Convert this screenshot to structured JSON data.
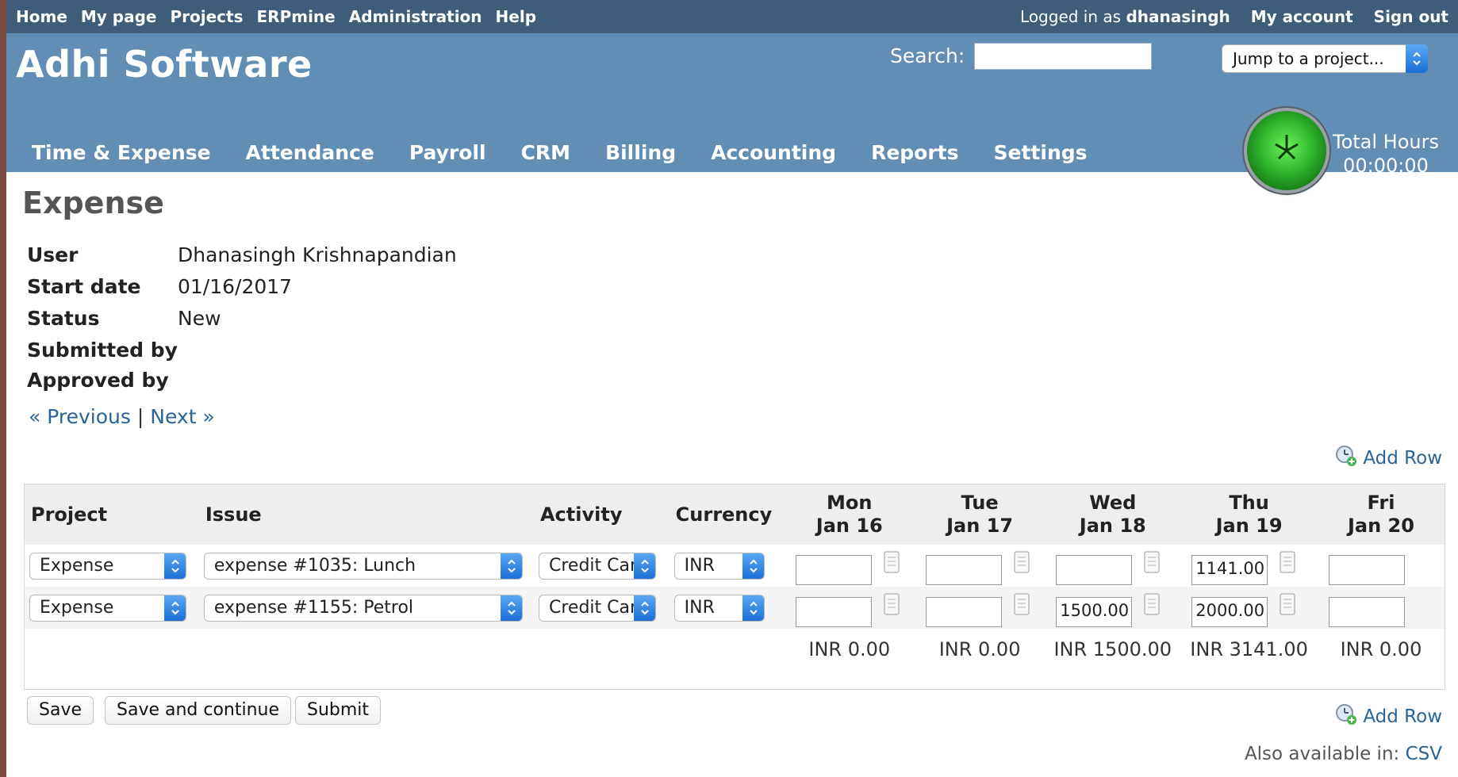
{
  "topnav": {
    "items": [
      "Home",
      "My page",
      "Projects",
      "ERPmine",
      "Administration",
      "Help"
    ],
    "logged_in_prefix": "Logged in as",
    "username": "dhanasingh",
    "my_account": "My account",
    "sign_out": "Sign out"
  },
  "header": {
    "brand": "Adhi Software",
    "search_label": "Search:",
    "search_value": "",
    "jump_label": "Jump to a project...",
    "total_hours_label": "Total Hours",
    "total_hours_value": "00:00:00"
  },
  "mainnav": [
    "Time & Expense",
    "Attendance",
    "Payroll",
    "CRM",
    "Billing",
    "Accounting",
    "Reports",
    "Settings"
  ],
  "page": {
    "title": "Expense",
    "fields": [
      {
        "label": "User",
        "value": "Dhanasingh Krishnapandian"
      },
      {
        "label": "Start date",
        "value": "01/16/2017"
      },
      {
        "label": "Status",
        "value": "New"
      },
      {
        "label": "Submitted by",
        "value": ""
      },
      {
        "label": "Approved by",
        "value": ""
      }
    ],
    "pager": {
      "previous": "« Previous",
      "separator": "|",
      "next": "Next »"
    },
    "add_row": "Add Row"
  },
  "table": {
    "headers": {
      "project": "Project",
      "issue": "Issue",
      "activity": "Activity",
      "currency": "Currency"
    },
    "days": [
      {
        "dow": "Mon",
        "date": "Jan 16"
      },
      {
        "dow": "Tue",
        "date": "Jan 17"
      },
      {
        "dow": "Wed",
        "date": "Jan 18"
      },
      {
        "dow": "Thu",
        "date": "Jan 19"
      },
      {
        "dow": "Fri",
        "date": "Jan 20"
      }
    ],
    "rows": [
      {
        "project": "Expense",
        "issue": "expense #1035: Lunch",
        "activity": "Credit Card",
        "currency": "INR",
        "values": [
          "",
          "",
          "",
          "1141.00",
          ""
        ]
      },
      {
        "project": "Expense",
        "issue": "expense #1155: Petrol",
        "activity": "Credit Card",
        "currency": "INR",
        "values": [
          "",
          "",
          "1500.00",
          "2000.00",
          ""
        ]
      }
    ],
    "totals": [
      "INR 0.00",
      "INR 0.00",
      "INR 1500.00",
      "INR 3141.00",
      "INR 0.00"
    ]
  },
  "buttons": {
    "save": "Save",
    "save_continue": "Save and continue",
    "submit": "Submit"
  },
  "footer": {
    "also_available": "Also available in:",
    "csv": "CSV"
  },
  "colors": {
    "topbar": "#3f5c79",
    "header": "#628db5",
    "link": "#2a6496",
    "clock": "#2fb52c"
  }
}
